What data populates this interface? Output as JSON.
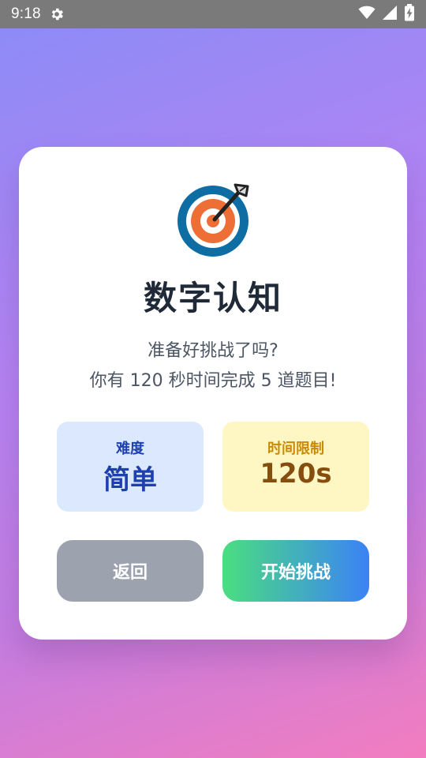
{
  "status_bar": {
    "time": "9:18",
    "icons": [
      "settings-gear-icon",
      "wifi-icon",
      "signal-icon",
      "battery-charging-icon"
    ]
  },
  "card": {
    "icon": "target-dart-icon",
    "title": "数字认知",
    "subtitle_line1": "准备好挑战了吗?",
    "subtitle_line2": "你有 120 秒时间完成 5 道题目!",
    "difficulty": {
      "label": "难度",
      "value": "简单"
    },
    "time_limit": {
      "label": "时间限制",
      "value": "120s"
    },
    "buttons": {
      "back": "返回",
      "start": "开始挑战"
    }
  },
  "colors": {
    "difficulty_bg": "#dbe8fd",
    "difficulty_text": "#1e40af",
    "time_bg": "#fef7c3",
    "time_label": "#ca8a04",
    "time_value": "#854d0e",
    "back_button": "#9ca3af",
    "start_gradient_from": "#4ade80",
    "start_gradient_to": "#3b82f6"
  }
}
